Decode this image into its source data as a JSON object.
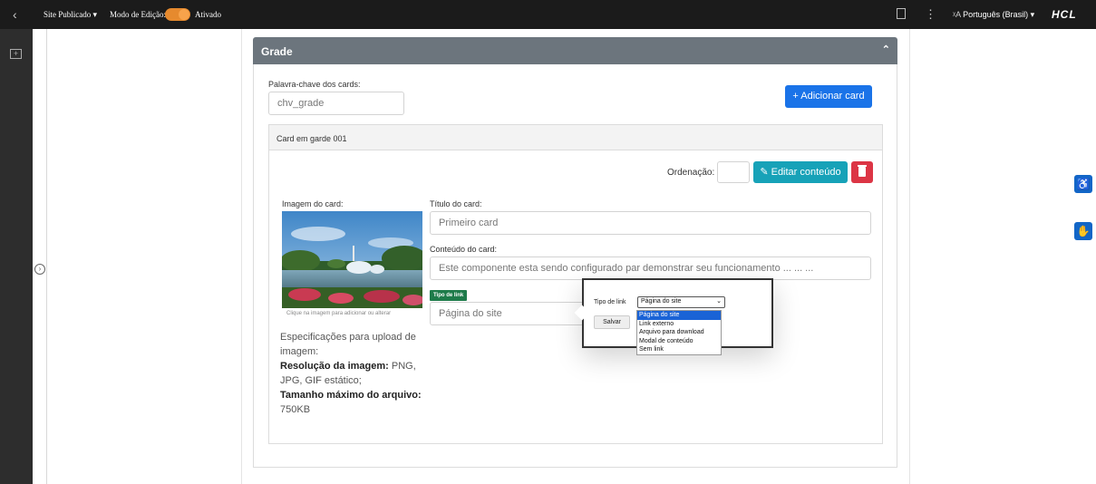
{
  "topbar": {
    "back_icon": "‹",
    "site_label": "Site Publicado",
    "site_caret": "▾",
    "mode_label": "Modo de Edição:",
    "mode_state": "Ativado",
    "menu_icon": "⋮",
    "language": "Português (Brasil)",
    "language_caret": "▾",
    "logo": "HCL",
    "accent_color": "#e68a2e"
  },
  "leftbar": {
    "add_icon": "+",
    "expand_icon": "›"
  },
  "panel": {
    "title": "Grade",
    "collapse_icon": "⌃",
    "keyword_label": "Palavra-chave dos cards:",
    "keyword_value": "chv_grade",
    "add_card_button": "+ Adicionar card",
    "card": {
      "header": "Card em garde 001",
      "order_label": "Ordenação:",
      "order_value": "",
      "edit_button": "✎ Editar conteúdo",
      "delete_icon": "trash-icon",
      "image_label": "Imagem do card:",
      "image_hint": "Clique na imagem para adicionar ou alterar",
      "title_label": "Título do card:",
      "title_value": "Primeiro card",
      "content_label": "Conteúdo do card:",
      "content_value": "Este componente esta sendo configurado par demonstrar seu funcionamento ... ... ...",
      "link_tag": "Tipo de link",
      "link_value": "Página do site",
      "spec_intro": "Especificações para upload de imagem:",
      "spec_res_label": "Resolução da imagem:",
      "spec_res_value": "PNG, JPG, GIF estático;",
      "spec_size_label": "Tamanho máximo do arquivo:",
      "spec_size_value": "750KB"
    }
  },
  "popup": {
    "type_label": "Tipo de link",
    "selected": "Página do site",
    "save_button": "Salvar",
    "options": [
      "Página do site",
      "Link externo",
      "Arquivo para download",
      "Modal de conteúdo",
      "Sem link"
    ]
  },
  "accessibility": {
    "icon1": "accessibility-icon",
    "icon2": "sign-language-icon"
  }
}
